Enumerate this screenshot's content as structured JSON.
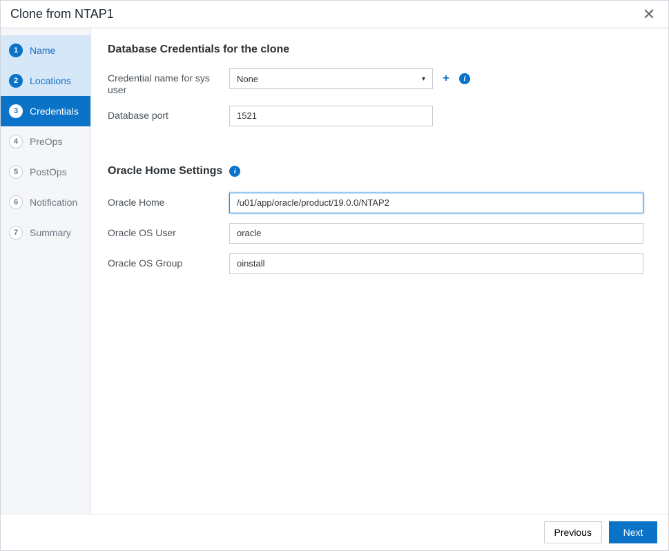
{
  "dialog": {
    "title": "Clone from NTAP1"
  },
  "steps": [
    {
      "num": "1",
      "label": "Name"
    },
    {
      "num": "2",
      "label": "Locations"
    },
    {
      "num": "3",
      "label": "Credentials"
    },
    {
      "num": "4",
      "label": "PreOps"
    },
    {
      "num": "5",
      "label": "PostOps"
    },
    {
      "num": "6",
      "label": "Notification"
    },
    {
      "num": "7",
      "label": "Summary"
    }
  ],
  "section1": {
    "title": "Database Credentials for the clone",
    "cred_label": "Credential name for sys user",
    "cred_value": "None",
    "port_label": "Database port",
    "port_value": "1521"
  },
  "section2": {
    "title": "Oracle Home Settings",
    "home_label": "Oracle Home",
    "home_value": "/u01/app/oracle/product/19.0.0/NTAP2",
    "osuser_label": "Oracle OS User",
    "osuser_value": "oracle",
    "osgroup_label": "Oracle OS Group",
    "osgroup_value": "oinstall"
  },
  "footer": {
    "previous": "Previous",
    "next": "Next"
  },
  "glyphs": {
    "info": "i",
    "plus": "+",
    "close": "✕",
    "caret": "▾"
  }
}
